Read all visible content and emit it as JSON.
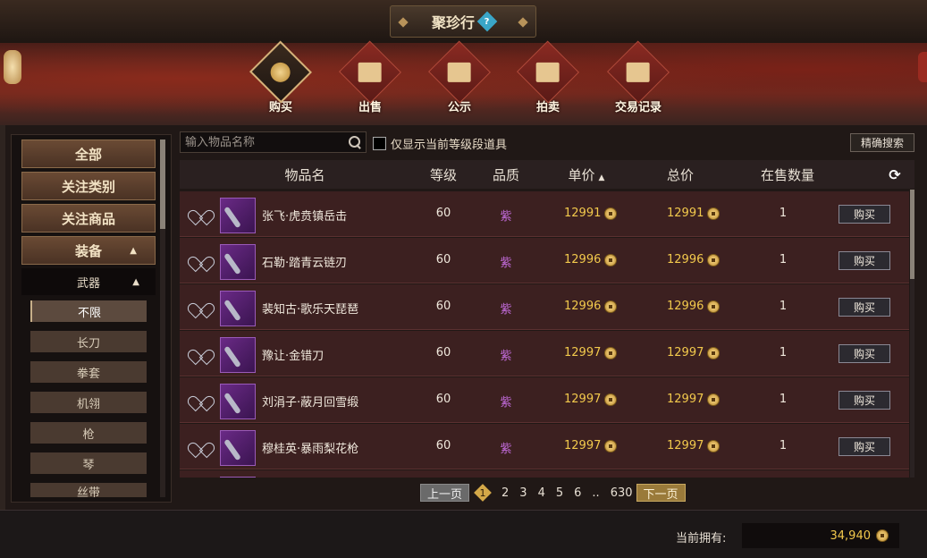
{
  "window": {
    "title": "聚珍行"
  },
  "nav_tabs": [
    {
      "label": "购买",
      "icon": "coin-icon",
      "active": true
    },
    {
      "label": "出售",
      "icon": "stall-icon",
      "active": false
    },
    {
      "label": "公示",
      "icon": "scroll-icon",
      "active": false
    },
    {
      "label": "拍卖",
      "icon": "gavel-icon",
      "active": false
    },
    {
      "label": "交易记录",
      "icon": "ledger-icon",
      "active": false
    }
  ],
  "sidebar": {
    "categories": [
      "全部",
      "关注类别",
      "关注商品",
      "装备"
    ],
    "subcategory": "武器",
    "leaves": [
      "不限",
      "长刀",
      "拳套",
      "机翎",
      "枪",
      "琴",
      "丝带"
    ]
  },
  "search": {
    "placeholder": "输入物品名称",
    "level_filter_label": "仅显示当前等级段道具",
    "precise_button": "精确搜索"
  },
  "table": {
    "headers": {
      "name": "物品名",
      "level": "等级",
      "quality": "品质",
      "price": "单价",
      "total": "总价",
      "qty": "在售数量"
    },
    "buy_label": "购买",
    "rows": [
      {
        "name": "张飞·虎贲镇岳击",
        "level": "60",
        "quality": "紫",
        "price": "12991",
        "total": "12991",
        "qty": "1"
      },
      {
        "name": "石勒·踏青云链刃",
        "level": "60",
        "quality": "紫",
        "price": "12996",
        "total": "12996",
        "qty": "1"
      },
      {
        "name": "裴知古·歌乐天琵琶",
        "level": "60",
        "quality": "紫",
        "price": "12996",
        "total": "12996",
        "qty": "1"
      },
      {
        "name": "豫让·金错刀",
        "level": "60",
        "quality": "紫",
        "price": "12997",
        "total": "12997",
        "qty": "1"
      },
      {
        "name": "刘涓子·蔽月回雪缎",
        "level": "60",
        "quality": "紫",
        "price": "12997",
        "total": "12997",
        "qty": "1"
      },
      {
        "name": "穆桂英·暴雨梨花枪",
        "level": "60",
        "quality": "紫",
        "price": "12997",
        "total": "12997",
        "qty": "1"
      }
    ]
  },
  "pager": {
    "prev": "上一页",
    "next": "下一页",
    "current": "1",
    "pages": [
      "2",
      "3",
      "4",
      "5",
      "6"
    ],
    "ellipsis": "..",
    "last": "630"
  },
  "footer": {
    "balance_label": "当前拥有:",
    "balance_value": "34,940"
  },
  "colors": {
    "accent_gold": "#f2c94c",
    "quality_purple": "#c06ad8",
    "banner_red": "#6a2a20"
  }
}
